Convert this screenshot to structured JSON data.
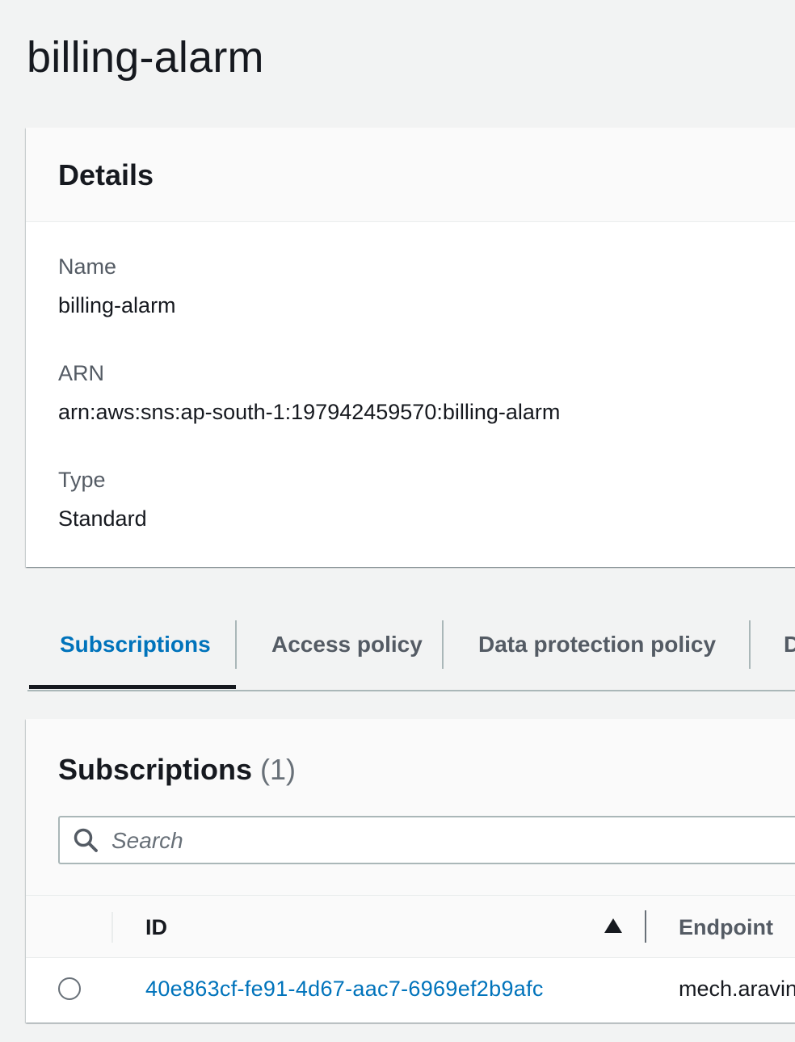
{
  "page": {
    "title": "billing-alarm"
  },
  "details": {
    "heading": "Details",
    "fields": [
      {
        "label": "Name",
        "value": "billing-alarm"
      },
      {
        "label": "ARN",
        "value": "arn:aws:sns:ap-south-1:197942459570:billing-alarm"
      },
      {
        "label": "Type",
        "value": "Standard"
      }
    ]
  },
  "tabs": [
    {
      "label": "Subscriptions",
      "active": true
    },
    {
      "label": "Access policy",
      "active": false
    },
    {
      "label": "Data protection policy",
      "active": false
    },
    {
      "label": "D",
      "active": false
    }
  ],
  "subscriptions": {
    "title": "Subscriptions",
    "count": "(1)",
    "search_placeholder": "Search",
    "columns": {
      "id": "ID",
      "endpoint": "Endpoint"
    },
    "rows": [
      {
        "id": "40e863cf-fe91-4d67-aac7-6969ef2b9afc",
        "endpoint": "mech.aravin"
      }
    ]
  },
  "colors": {
    "background": "#f2f3f3",
    "link": "#0073bb",
    "text": "#16191f",
    "muted": "#545b64"
  },
  "icons": {
    "search": "search-icon",
    "sort": "sort-ascending-icon",
    "radio": "radio-button"
  }
}
